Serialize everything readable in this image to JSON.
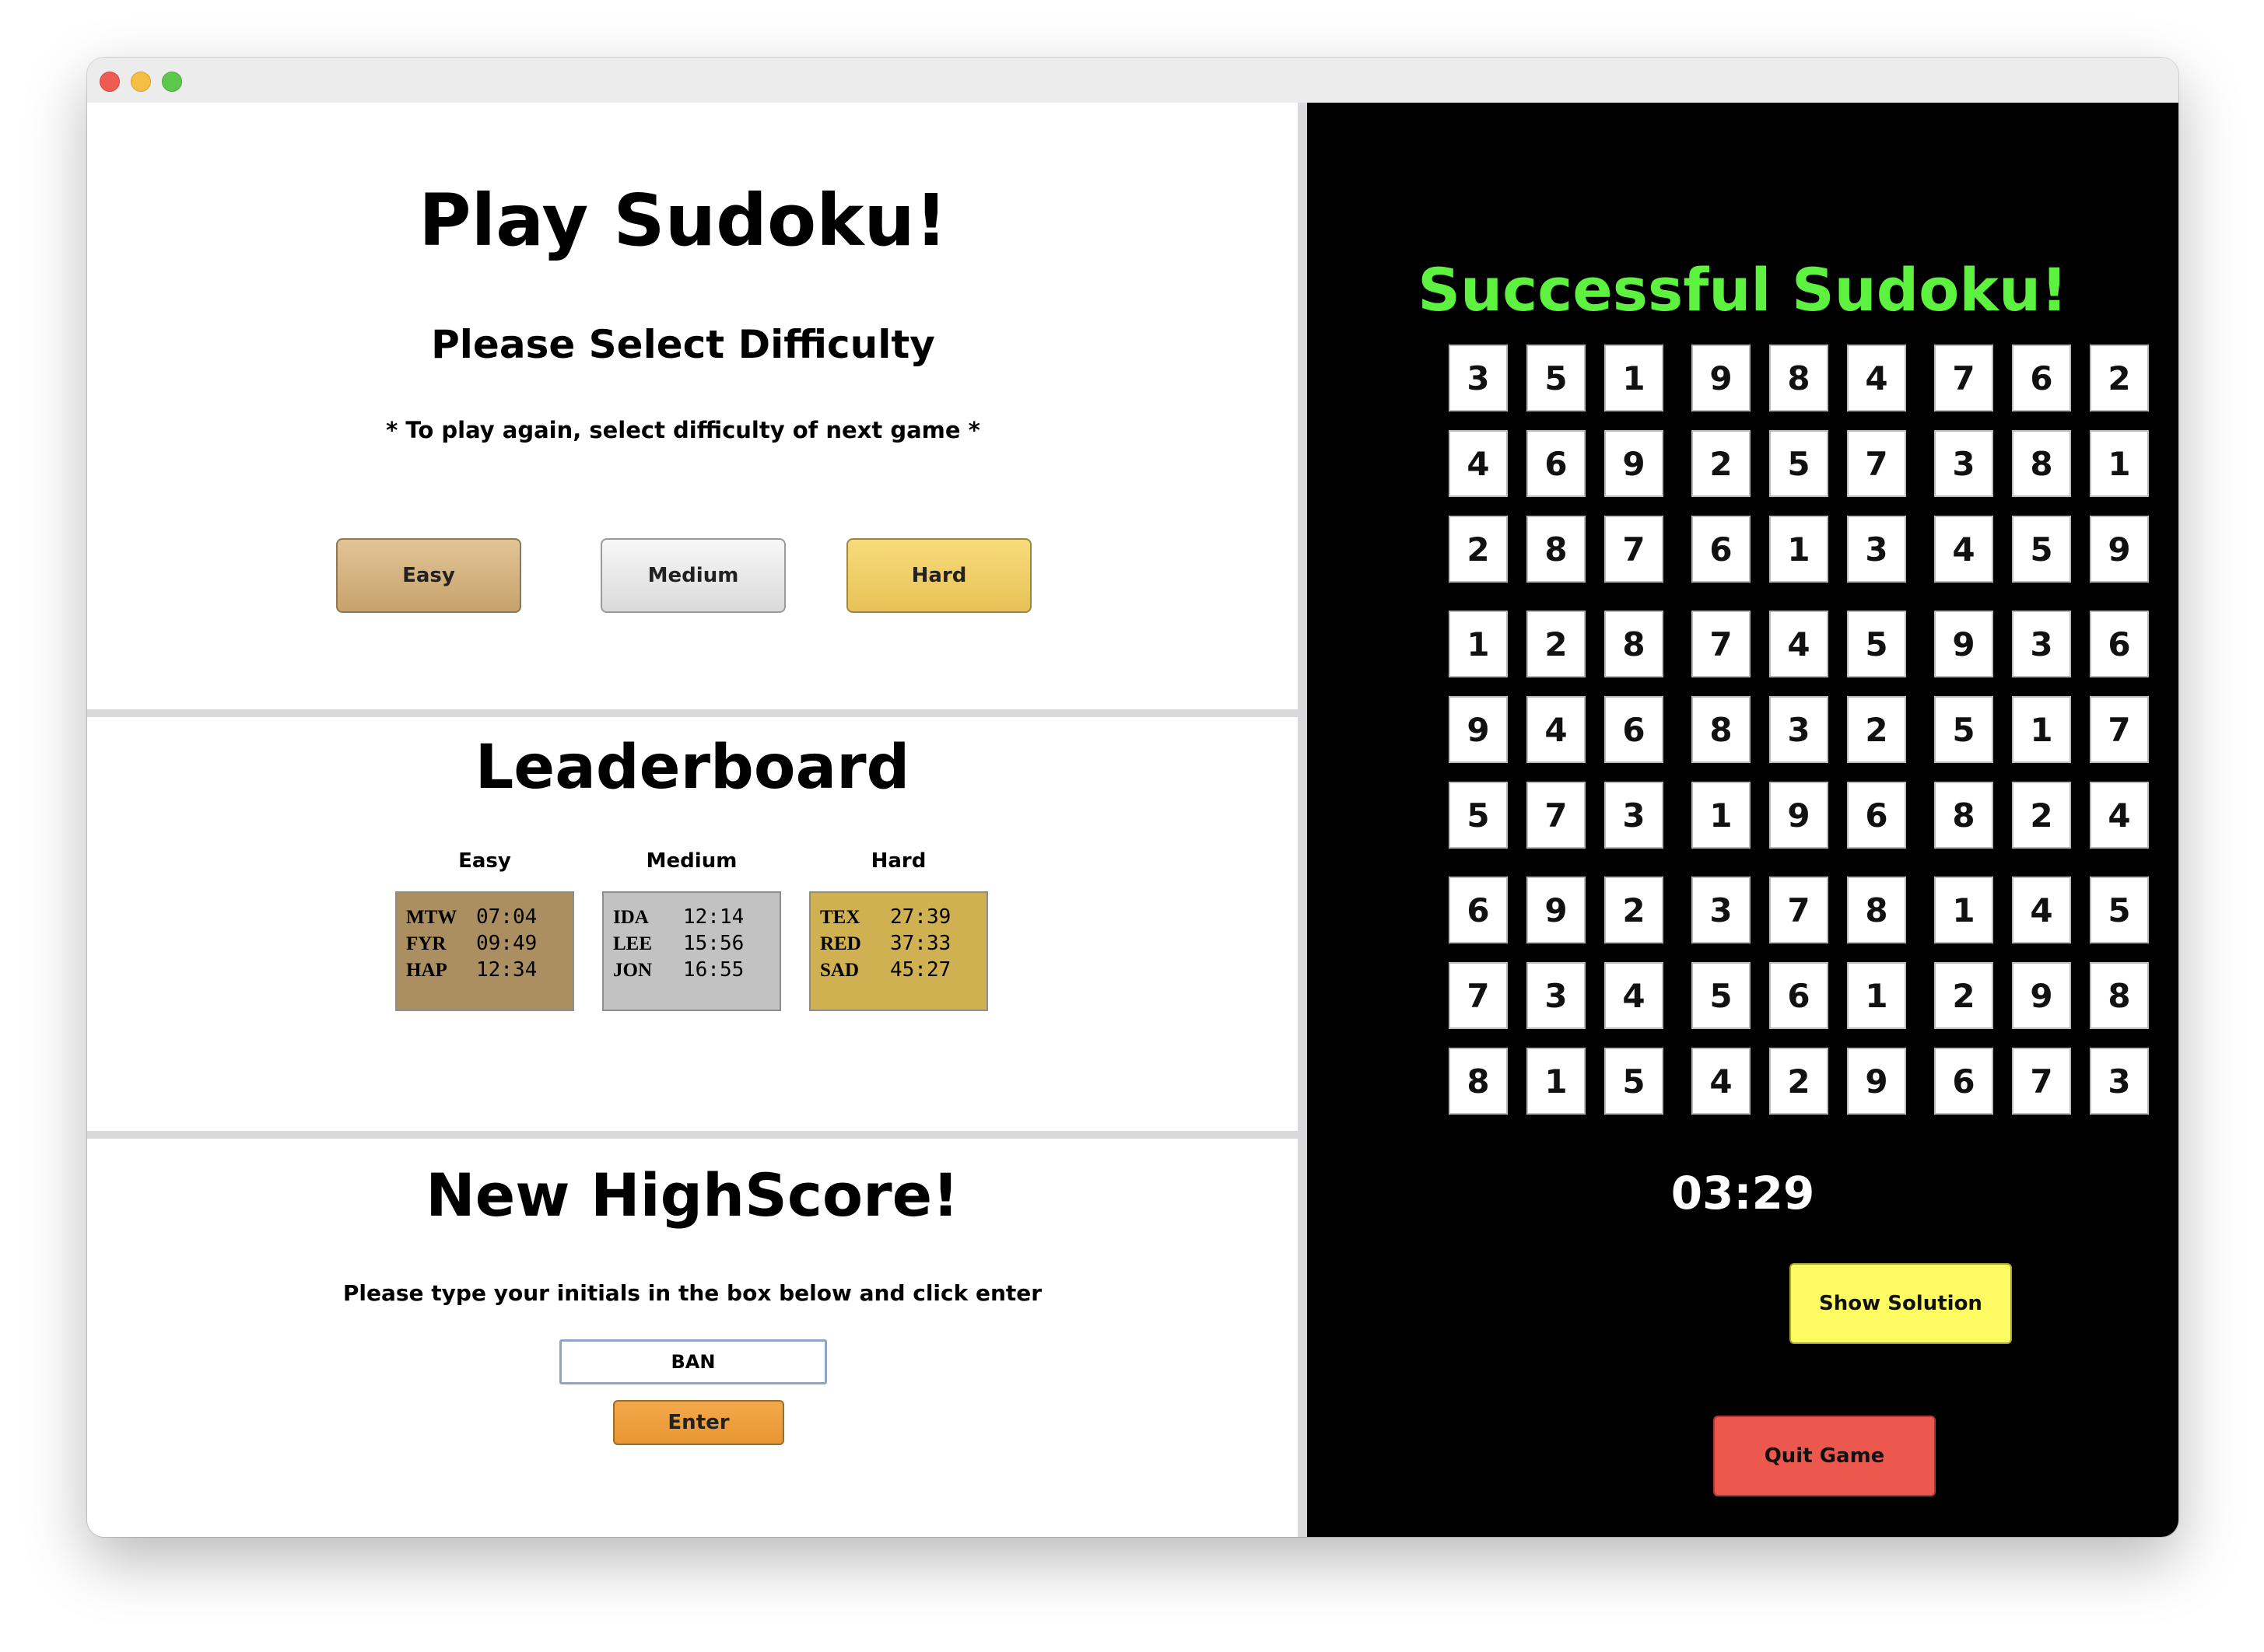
{
  "window": {
    "controls": [
      "close-icon",
      "minimize-icon",
      "maximize-icon"
    ]
  },
  "play": {
    "title": "Play Sudoku!",
    "subtitle": "Please Select Difficulty",
    "note": "* To play again, select difficulty of next game *",
    "buttons": {
      "easy": "Easy",
      "medium": "Medium",
      "hard": "Hard"
    }
  },
  "leaderboard": {
    "title": "Leaderboard",
    "columns": [
      {
        "title": "Easy",
        "entries": [
          {
            "initials": "MTW",
            "time": "07:04"
          },
          {
            "initials": "FYR",
            "time": "09:49"
          },
          {
            "initials": "HAP",
            "time": "12:34"
          }
        ]
      },
      {
        "title": "Medium",
        "entries": [
          {
            "initials": "IDA",
            "time": "12:14"
          },
          {
            "initials": "LEE",
            "time": "15:56"
          },
          {
            "initials": "JON",
            "time": "16:55"
          }
        ]
      },
      {
        "title": "Hard",
        "entries": [
          {
            "initials": "TEX",
            "time": "27:39"
          },
          {
            "initials": "RED",
            "time": "37:33"
          },
          {
            "initials": "SAD",
            "time": "45:27"
          }
        ]
      }
    ]
  },
  "highscore": {
    "title": "New HighScore!",
    "instructions": "Please type your initials in the box below and click enter",
    "input_value": "BAN",
    "enter_label": "Enter"
  },
  "game": {
    "title": "Successful Sudoku!",
    "grid": [
      [
        3,
        5,
        1,
        9,
        8,
        4,
        7,
        6,
        2
      ],
      [
        4,
        6,
        9,
        2,
        5,
        7,
        3,
        8,
        1
      ],
      [
        2,
        8,
        7,
        6,
        1,
        3,
        4,
        5,
        9
      ],
      [
        1,
        2,
        8,
        7,
        4,
        5,
        9,
        3,
        6
      ],
      [
        9,
        4,
        6,
        8,
        3,
        2,
        5,
        1,
        7
      ],
      [
        5,
        7,
        3,
        1,
        9,
        6,
        8,
        2,
        4
      ],
      [
        6,
        9,
        2,
        3,
        7,
        8,
        1,
        4,
        5
      ],
      [
        7,
        3,
        4,
        5,
        6,
        1,
        2,
        9,
        8
      ],
      [
        8,
        1,
        5,
        4,
        2,
        9,
        6,
        7,
        3
      ]
    ],
    "timer": "03:29",
    "show_solution_label": "Show Solution",
    "quit_label": "Quit Game",
    "colors": {
      "title": "#5df23f",
      "show_solution": "#fcfc62",
      "quit": "#ec574e"
    }
  }
}
